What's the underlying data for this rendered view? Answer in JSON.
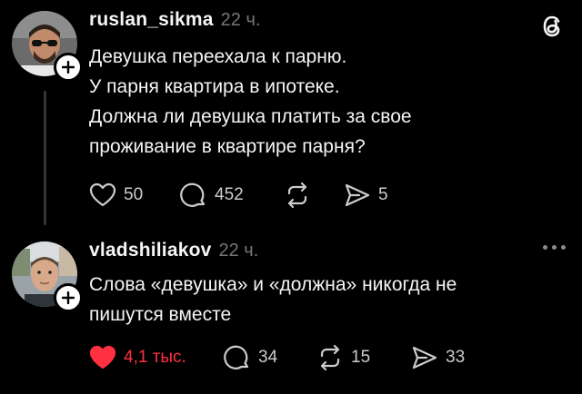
{
  "app": {
    "logo_icon": "threads-logo-icon"
  },
  "posts": [
    {
      "username": "ruslan_sikma",
      "time": "22 ч.",
      "lines": [
        "Девушка переехала к парню.",
        "У парня квартира в ипотеке.",
        "Должна ли девушка платить за свое",
        "проживание в квартире парня?"
      ],
      "likes": "50",
      "comments": "452",
      "shares": "5",
      "liked": false
    },
    {
      "username": "vladshiliakov",
      "time": "22 ч.",
      "lines": [
        "Слова «девушка» и «должна» никогда не",
        "пишутся вместе"
      ],
      "likes": "4,1 тыс.",
      "comments": "34",
      "reposts": "15",
      "shares": "33",
      "liked": true
    }
  ],
  "colors": {
    "like_active": "#ff3040",
    "muted": "#777777"
  }
}
